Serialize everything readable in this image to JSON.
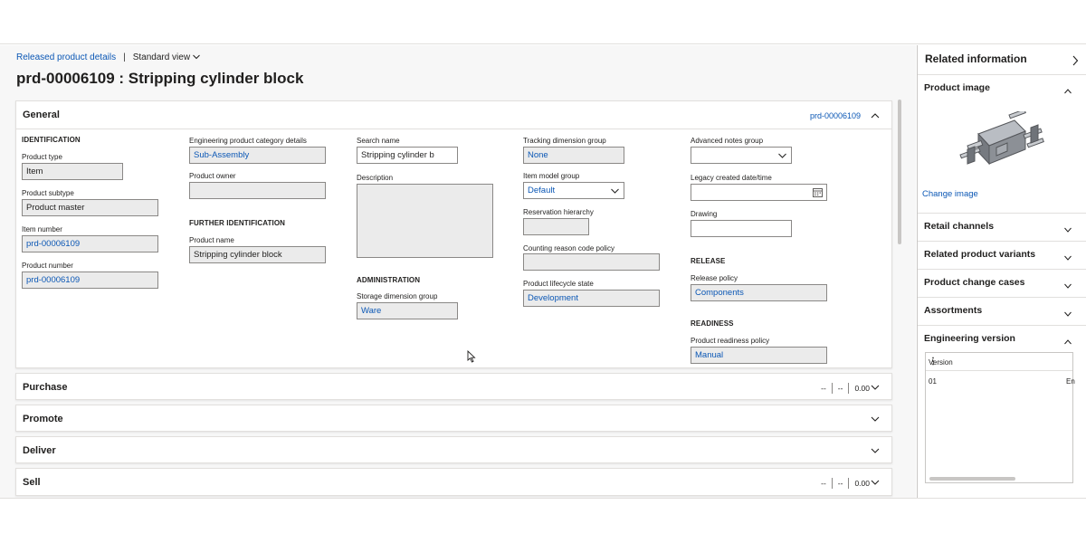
{
  "breadcrumb": {
    "link": "Released product details",
    "separator": "|",
    "view": "Standard view"
  },
  "page_title": "prd-00006109 : Stripping cylinder block",
  "general": {
    "title": "General",
    "header_id": "prd-00006109",
    "identification": {
      "heading": "IDENTIFICATION",
      "product_type_label": "Product type",
      "product_type": "Item",
      "product_subtype_label": "Product subtype",
      "product_subtype": "Product master",
      "item_number_label": "Item number",
      "item_number": "prd-00006109",
      "product_number_label": "Product number",
      "product_number": "prd-00006109"
    },
    "engineering": {
      "category_label": "Engineering product category details",
      "category": "Sub-Assembly",
      "owner_label": "Product owner",
      "owner": ""
    },
    "further_identification": {
      "heading": "FURTHER IDENTIFICATION",
      "product_name_label": "Product name",
      "product_name": "Stripping cylinder block"
    },
    "search": {
      "search_name_label": "Search name",
      "search_name": "Stripping cylinder b",
      "description_label": "Description",
      "description": ""
    },
    "administration": {
      "heading": "ADMINISTRATION",
      "storage_label": "Storage dimension group",
      "storage": "Ware"
    },
    "tracking": {
      "tracking_label": "Tracking dimension group",
      "tracking": "None",
      "item_model_label": "Item model group",
      "item_model": "Default",
      "reservation_label": "Reservation hierarchy",
      "reservation": "",
      "counting_label": "Counting reason code policy",
      "counting": "",
      "lifecycle_label": "Product lifecycle state",
      "lifecycle": "Development"
    },
    "notes": {
      "advanced_notes_label": "Advanced notes group",
      "advanced_notes": "",
      "legacy_label": "Legacy created date/time",
      "legacy": "",
      "drawing_label": "Drawing",
      "drawing": ""
    },
    "release": {
      "heading": "RELEASE",
      "policy_label": "Release policy",
      "policy": "Components"
    },
    "readiness": {
      "heading": "READINESS",
      "policy_label": "Product readiness policy",
      "policy": "Manual"
    }
  },
  "sections": {
    "purchase": {
      "title": "Purchase",
      "s1": "--",
      "s2": "--",
      "s3": "0.00"
    },
    "promote": {
      "title": "Promote"
    },
    "deliver": {
      "title": "Deliver"
    },
    "sell": {
      "title": "Sell",
      "s1": "--",
      "s2": "--",
      "s3": "0.00"
    }
  },
  "side": {
    "title": "Related information",
    "product_image": "Product image",
    "change_image": "Change image",
    "retail_channels": "Retail channels",
    "related_variants": "Related product variants",
    "change_cases": "Product change cases",
    "assortments": "Assortments",
    "engineering_version": "Engineering version",
    "grid": {
      "column": "Version",
      "more": "⋮",
      "rows": [
        {
          "version": "01",
          "next": "En"
        }
      ]
    }
  },
  "colors": {
    "link": "#0b57b5",
    "field_bg": "#ebebeb",
    "border": "#8a8886"
  },
  "icons": [
    "chevron-down-icon",
    "chevron-up-icon",
    "chevron-right-icon",
    "calendar-icon",
    "more-icon",
    "mouse-cursor-icon"
  ]
}
